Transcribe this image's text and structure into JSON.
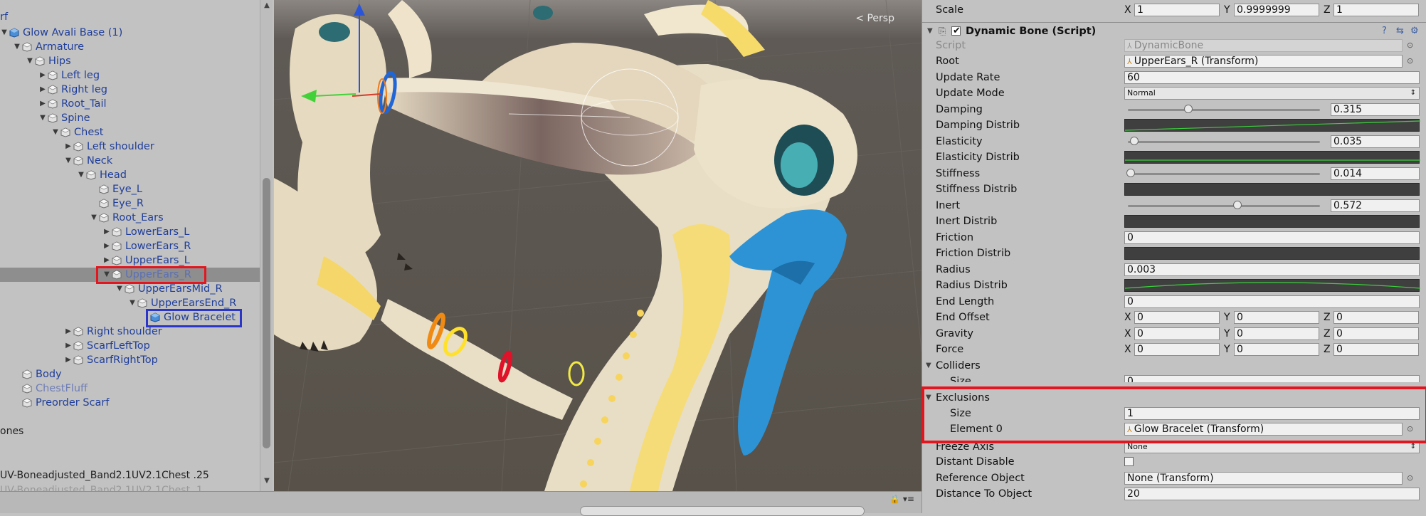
{
  "hierarchy": {
    "root_cut_text": "rf",
    "items": [
      {
        "label": "Glow Avali Base (1)",
        "depth": 0,
        "fold": "open",
        "icon": "prefab-icon"
      },
      {
        "label": "Armature",
        "depth": 1,
        "fold": "open"
      },
      {
        "label": "Hips",
        "depth": 2,
        "fold": "open"
      },
      {
        "label": "Left leg",
        "depth": 3,
        "fold": "closed"
      },
      {
        "label": "Right leg",
        "depth": 3,
        "fold": "closed"
      },
      {
        "label": "Root_Tail",
        "depth": 3,
        "fold": "closed"
      },
      {
        "label": "Spine",
        "depth": 3,
        "fold": "open"
      },
      {
        "label": "Chest",
        "depth": 4,
        "fold": "open"
      },
      {
        "label": "Left shoulder",
        "depth": 5,
        "fold": "closed"
      },
      {
        "label": "Neck",
        "depth": 5,
        "fold": "open"
      },
      {
        "label": "Head",
        "depth": 6,
        "fold": "open"
      },
      {
        "label": "Eye_L",
        "depth": 7,
        "fold": "none"
      },
      {
        "label": "Eye_R",
        "depth": 7,
        "fold": "none"
      },
      {
        "label": "Root_Ears",
        "depth": 7,
        "fold": "open"
      },
      {
        "label": "LowerEars_L",
        "depth": 8,
        "fold": "closed"
      },
      {
        "label": "LowerEars_R",
        "depth": 8,
        "fold": "closed"
      },
      {
        "label": "UpperEars_L",
        "depth": 8,
        "fold": "closed"
      },
      {
        "label": "UpperEars_R",
        "depth": 8,
        "fold": "open",
        "selected": true
      },
      {
        "label": "UpperEarsMid_R",
        "depth": 9,
        "fold": "open"
      },
      {
        "label": "UpperEarsEnd_R",
        "depth": 10,
        "fold": "open"
      },
      {
        "label": "Glow Bracelet",
        "depth": 11,
        "fold": "none",
        "icon": "prefab-icon"
      },
      {
        "label": "Right shoulder",
        "depth": 5,
        "fold": "closed"
      },
      {
        "label": "ScarfLeftTop",
        "depth": 5,
        "fold": "closed"
      },
      {
        "label": "ScarfRightTop",
        "depth": 5,
        "fold": "closed"
      },
      {
        "label": "Body",
        "depth": 1,
        "fold": "none"
      },
      {
        "label": "ChestFluff",
        "depth": 1,
        "fold": "none",
        "dim": true
      },
      {
        "label": "Preorder Scarf",
        "depth": 1,
        "fold": "none"
      }
    ],
    "bones_cut_text": "ones",
    "bottom_line_1": "UV-Boneadjusted_Band2.1UV2.1Chest .25",
    "bottom_line_2": "UV-Boneadjusted_Band2.1UV2.1Chest .1"
  },
  "scene": {
    "persp_label": "< Persp"
  },
  "inspector": {
    "scale": {
      "label": "Scale",
      "x": "1",
      "y": "0.9999999",
      "z": "1"
    },
    "component_title": "Dynamic Bone (Script)",
    "props": {
      "script": {
        "label": "Script",
        "value": "DynamicBone"
      },
      "root": {
        "label": "Root",
        "value": "UpperEars_R (Transform)"
      },
      "update_rate": {
        "label": "Update Rate",
        "value": "60"
      },
      "update_mode": {
        "label": "Update Mode",
        "value": "Normal"
      },
      "damping": {
        "label": "Damping",
        "value": "0.315",
        "fraction": 0.315
      },
      "damping_distrib": {
        "label": "Damping Distrib"
      },
      "elasticity": {
        "label": "Elasticity",
        "value": "0.035",
        "fraction": 0.035
      },
      "elasticity_distrib": {
        "label": "Elasticity Distrib"
      },
      "stiffness": {
        "label": "Stiffness",
        "value": "0.014",
        "fraction": 0.014
      },
      "stiffness_distrib": {
        "label": "Stiffness Distrib"
      },
      "inert": {
        "label": "Inert",
        "value": "0.572",
        "fraction": 0.572
      },
      "inert_distrib": {
        "label": "Inert Distrib"
      },
      "friction": {
        "label": "Friction",
        "value": "0"
      },
      "friction_distrib": {
        "label": "Friction Distrib"
      },
      "radius": {
        "label": "Radius",
        "value": "0.003"
      },
      "radius_distrib": {
        "label": "Radius Distrib"
      },
      "end_length": {
        "label": "End Length",
        "value": "0"
      },
      "end_offset": {
        "label": "End Offset",
        "x": "0",
        "y": "0",
        "z": "0"
      },
      "gravity": {
        "label": "Gravity",
        "x": "0",
        "y": "0",
        "z": "0"
      },
      "force": {
        "label": "Force",
        "x": "0",
        "y": "0",
        "z": "0"
      },
      "colliders": {
        "label": "Colliders",
        "size_label": "Size",
        "size": "0"
      },
      "exclusions": {
        "label": "Exclusions",
        "size_label": "Size",
        "size": "1",
        "element0_label": "Element 0",
        "element0": "Glow Bracelet (Transform)"
      },
      "freeze_axis": {
        "label": "Freeze Axis",
        "value": "None"
      },
      "distant_disable": {
        "label": "Distant Disable",
        "checked": false
      },
      "reference_object": {
        "label": "Reference Object",
        "value": "None (Transform)"
      },
      "distance_to_object": {
        "label": "Distance To Object",
        "value": "20"
      }
    },
    "axis_labels": {
      "x": "X",
      "y": "Y",
      "z": "Z"
    }
  },
  "colors": {
    "highlight_red": "#e3161f",
    "highlight_blue": "#2b35c8",
    "hierarchy_text": "#1f3e9a",
    "scene_bg": "#5a554f"
  }
}
